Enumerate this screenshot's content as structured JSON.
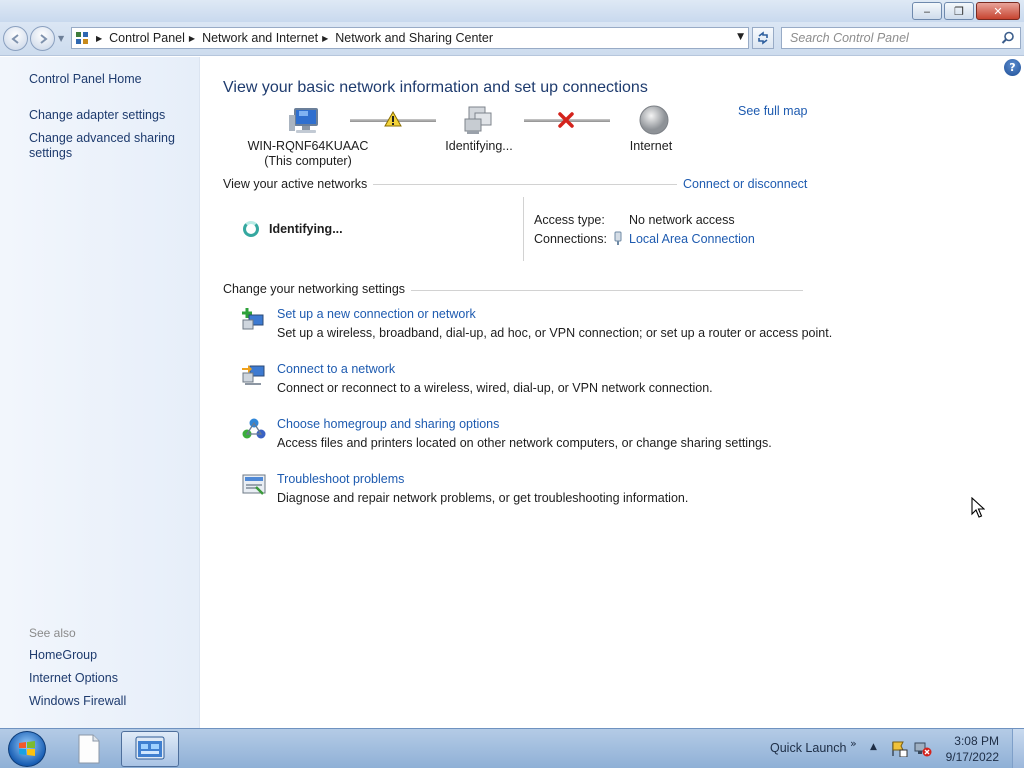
{
  "window": {
    "minimize_label": "‒",
    "maximize_label": "❐",
    "close_label": "✕"
  },
  "address": {
    "crumbs": [
      "Control Panel",
      "Network and Internet",
      "Network and Sharing Center"
    ],
    "search_placeholder": "Search Control Panel"
  },
  "sidebar": {
    "home": "Control Panel Home",
    "links": [
      "Change adapter settings",
      "Change advanced sharing settings"
    ],
    "see_also_header": "See also",
    "see_also": [
      "HomeGroup",
      "Internet Options",
      "Windows Firewall"
    ]
  },
  "main": {
    "title": "View your basic network information and set up connections",
    "see_full_map": "See full map",
    "map": {
      "computer_name": "WIN-RQNF64KUAAC",
      "computer_sub": "(This computer)",
      "network_label": "Identifying...",
      "internet_label": "Internet"
    },
    "active_networks": {
      "header": "View your active networks",
      "connect_link": "Connect or disconnect",
      "network_name": "Identifying...",
      "access_type_label": "Access type:",
      "access_type_value": "No network access",
      "connections_label": "Connections:",
      "connections_value": "Local Area Connection"
    },
    "settings": {
      "header": "Change your networking settings",
      "tasks": [
        {
          "title": "Set up a new connection or network",
          "desc": "Set up a wireless, broadband, dial-up, ad hoc, or VPN connection; or set up a router or access point."
        },
        {
          "title": "Connect to a network",
          "desc": "Connect or reconnect to a wireless, wired, dial-up, or VPN network connection."
        },
        {
          "title": "Choose homegroup and sharing options",
          "desc": "Access files and printers located on other network computers, or change sharing settings."
        },
        {
          "title": "Troubleshoot problems",
          "desc": "Diagnose and repair network problems, or get troubleshooting information."
        }
      ]
    }
  },
  "taskbar": {
    "quick_launch": "Quick Launch",
    "time": "3:08 PM",
    "date": "9/17/2022"
  },
  "colors": {
    "link": "#1e5bb0",
    "heading": "#1e3b6e",
    "sidebar_bg": "#e9f0fa",
    "taskbar_bg": "#a0bcdf"
  }
}
